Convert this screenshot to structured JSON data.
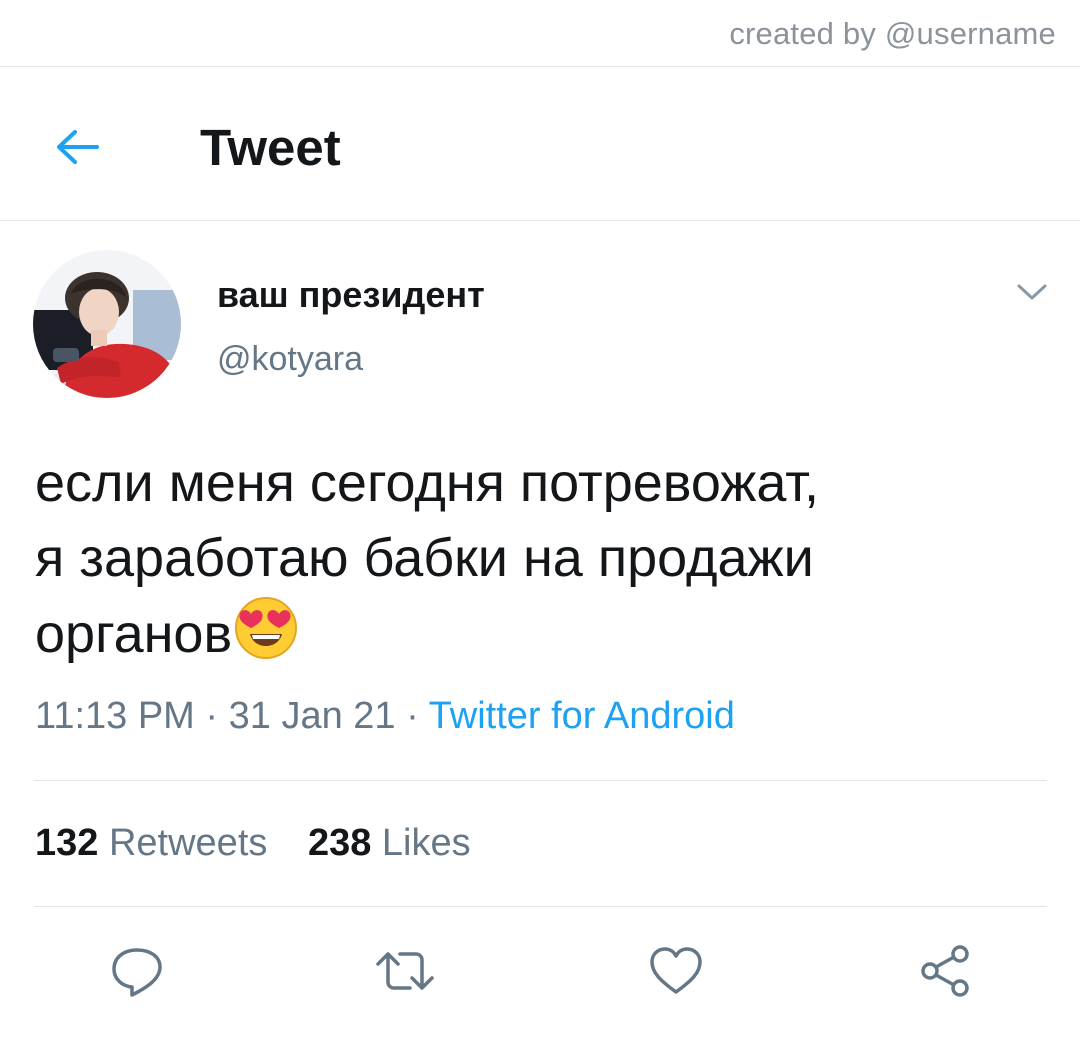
{
  "credit": "created by @username",
  "header": {
    "back_icon": "arrow-left-icon",
    "title": "Tweet"
  },
  "author": {
    "display_name": "ваш президент",
    "handle": "@kotyara",
    "avatar": "avatar-photo"
  },
  "tweet": {
    "lines": [
      "если меня сегодня потревожат,",
      "я заработаю бабки на продажи",
      "органов"
    ],
    "emoji": "smiling-face-with-heart-eyes-emoji"
  },
  "meta": {
    "time": "11:13 PM",
    "separator": "·",
    "date": "31 Jan 21",
    "source": "Twitter for Android"
  },
  "stats": {
    "retweets_count": "132",
    "retweets_label": "Retweets",
    "likes_count": "238",
    "likes_label": "Likes"
  },
  "actions": [
    {
      "icon": "reply-icon"
    },
    {
      "icon": "retweet-icon"
    },
    {
      "icon": "like-icon"
    },
    {
      "icon": "share-icon"
    }
  ],
  "colors": {
    "accent": "#1da1f2",
    "text": "#14171a",
    "secondary_text": "#657786",
    "divider": "#e1e6ea"
  }
}
